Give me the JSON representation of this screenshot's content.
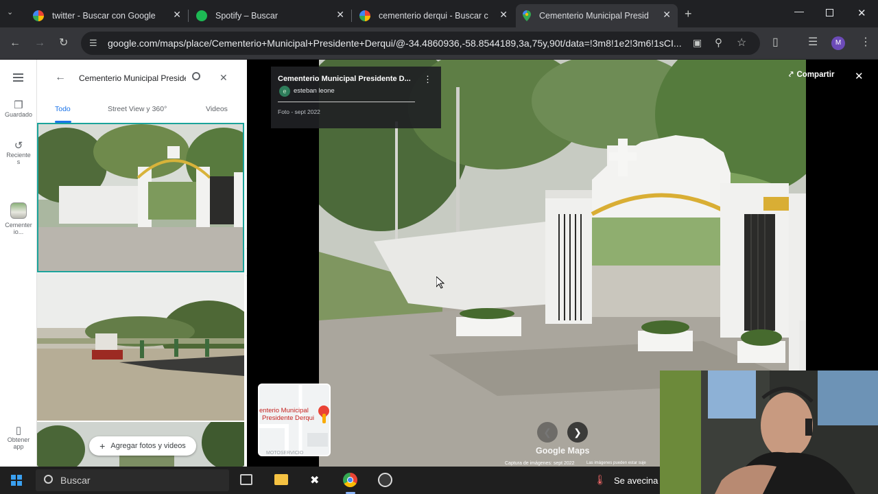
{
  "browser": {
    "tabs": [
      {
        "title": "twitter - Buscar con Google",
        "icon": "google-icon",
        "active": false
      },
      {
        "title": "Spotify – Buscar",
        "icon": "spotify-icon",
        "active": false
      },
      {
        "title": "cementerio derqui - Buscar con Google",
        "icon": "google-icon",
        "active": false
      },
      {
        "title": "Cementerio Municipal Presidente Derqui",
        "icon": "maps-pin-icon",
        "active": true
      }
    ],
    "url": "google.com/maps/place/Cementerio+Municipal+Presidente+Derqui/@-34.4860936,-58.8544189,3a,75y,90t/data=!3m8!1e2!3m6!1sCI...",
    "profile_initial": "M"
  },
  "rail": {
    "saved": "Guardado",
    "recent_1": "Reciente",
    "recent_2": "s",
    "place_1": "Cementer",
    "place_2": "io...",
    "get_app_1": "Obtener",
    "get_app_2": "app"
  },
  "panel": {
    "search_text": "Cementerio Municipal Preside",
    "tabs": [
      "Todo",
      "Street View y 360°",
      "Videos"
    ],
    "add_photos": "Agregar fotos y videos"
  },
  "viewer": {
    "title": "Cementerio Municipal Presidente D...",
    "user_initial": "e",
    "user": "esteban leone",
    "date": "Foto - sept 2022",
    "share": "Compartir",
    "minimap_label_1": "enterio Municipal",
    "minimap_label_2": "Presidente Derqui",
    "minimap_footer": "MOTOSERVICIO",
    "brand": "Google Maps",
    "capture": "Captura de imágenes: sept 2022",
    "disclaimer": "Las imágenes pueden estar suje"
  },
  "taskbar": {
    "search": "Buscar",
    "weather": "Se avecina"
  },
  "colors": {
    "accent": "#1a73e8",
    "selected_border": "#1aa39a",
    "dark_bg": "#202124"
  }
}
